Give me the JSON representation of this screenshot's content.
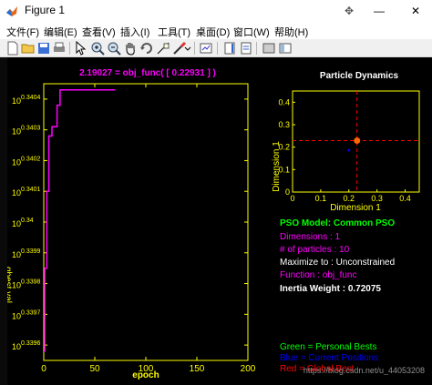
{
  "window": {
    "title": "Figure 1",
    "minimize_glyph": "—",
    "maximize_glyph": "☐",
    "close_glyph": "✕",
    "close_hover_glyph": "⦿",
    "hover_glyph": "✥"
  },
  "menu": {
    "items": [
      "文件(F)",
      "编辑(E)",
      "查看(V)",
      "插入(I)",
      "工具(T)",
      "桌面(D)",
      "窗口(W)",
      "帮助(H)"
    ]
  },
  "toolbar": {
    "icons": [
      "new-file-icon",
      "open-folder-icon",
      "save-icon",
      "print-icon",
      "pointer-icon",
      "zoom-in-icon",
      "zoom-out-icon",
      "pan-hand-icon",
      "rotate-icon",
      "data-cursor-icon",
      "brush-icon",
      "link-plot-icon",
      "colorbar-icon",
      "legend-icon",
      "hide-plot-tools-icon",
      "show-plot-tools-icon"
    ]
  },
  "colors": {
    "figure_bg": "#000000",
    "axes_color": "#ffff00",
    "line_color": "#ff00ff",
    "title_color": "#ff00ff",
    "best_color": "#ff6600",
    "crosshair": "#ff0000",
    "green": "#00ff00",
    "blue": "#0000ff",
    "red": "#ff0000",
    "white": "#ffffff"
  },
  "chart_data": [
    {
      "type": "line",
      "title": "2.19027 = obj_func( [   0.22931 ] )",
      "xlabel": "epoch",
      "ylabel": "gbest val.",
      "xlim": [
        0,
        200
      ],
      "ylim": [
        0.33955,
        0.34045
      ],
      "yscale": "log",
      "xticks": [
        0,
        50,
        100,
        150,
        200
      ],
      "yticks": [
        0.3396,
        0.3397,
        0.3398,
        0.3399,
        0.34,
        0.3401,
        0.3402,
        0.3403,
        0.3404
      ],
      "ytick_labels": [
        "0.3396",
        "0.3397",
        "0.3398",
        "0.3399",
        "0.34",
        "0.3401",
        "0.3402",
        "0.3403",
        "0.3404"
      ],
      "ytick_base": "10",
      "series": [
        {
          "x": [
            0,
            1,
            1,
            3,
            3,
            5,
            5,
            8,
            8,
            13,
            13,
            16,
            16,
            60,
            65,
            70
          ],
          "y": [
            0.33958,
            0.33958,
            0.33985,
            0.33985,
            0.3401,
            0.3401,
            0.34028,
            0.34028,
            0.34031,
            0.34031,
            0.34038,
            0.34038,
            0.34043,
            0.34043,
            0.34043,
            0.34043
          ]
        }
      ]
    },
    {
      "type": "scatter",
      "title": "Particle Dynamics",
      "xlabel": "Dimension 1",
      "ylabel": "Dimension 1",
      "xlim": [
        0,
        0.45
      ],
      "ylim": [
        0,
        0.45
      ],
      "xticks": [
        0,
        0.1,
        0.2,
        0.3,
        0.4
      ],
      "yticks": [
        0,
        0.1,
        0.2,
        0.3,
        0.4
      ],
      "tick_labels": [
        "0",
        "0.1",
        "0.2",
        "0.3",
        "0.4"
      ],
      "points": [
        {
          "x": 0.229,
          "y": 0.229,
          "color": "#ff6600",
          "kind": "global-best"
        },
        {
          "x": 0.2,
          "y": 0.186,
          "color": "#0000ff",
          "kind": "particle"
        }
      ],
      "crosshair": {
        "x": 0.229,
        "y": 0.229
      }
    }
  ],
  "info": {
    "model": "PSO Model: Common PSO",
    "dimensions": "Dimensions : 1",
    "particles": "# of particles : 10",
    "maximize": "Maximize to : Unconstrained",
    "function": "Function : obj_func",
    "inertia": "Inertia Weight : 0.72075"
  },
  "legend": {
    "green": "Green = Personal Bests",
    "blue": "Blue = Current Positions",
    "red": "Red = Global Best"
  },
  "watermark": "https://blog.csdn.net/u_44053208"
}
